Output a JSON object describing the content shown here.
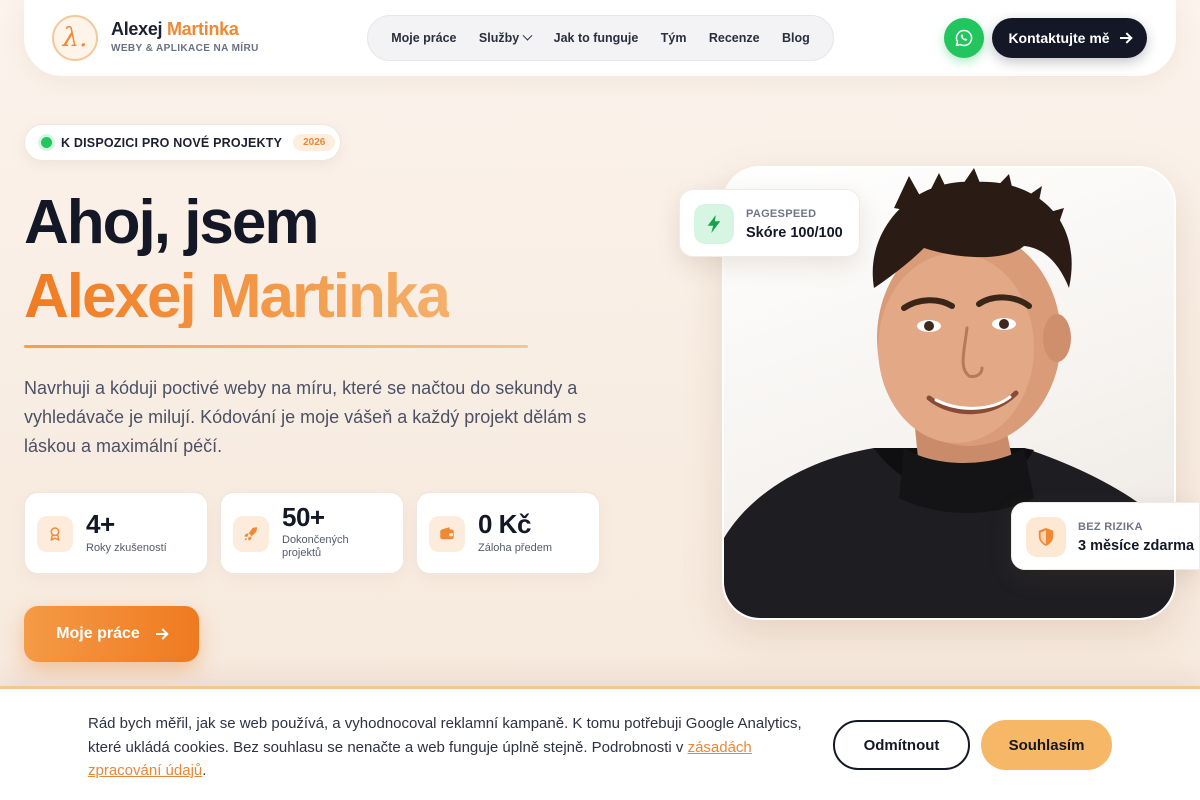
{
  "header": {
    "brand_first": "Alexej",
    "brand_last": "Martinka",
    "brand_tagline": "WEBY & APLIKACE NA MÍRU",
    "brand_logo_glyph": "λ.",
    "nav": [
      {
        "label": "Moje práce"
      },
      {
        "label": "Služby",
        "has_dropdown": true
      },
      {
        "label": "Jak to funguje"
      },
      {
        "label": "Tým"
      },
      {
        "label": "Recenze"
      },
      {
        "label": "Blog"
      }
    ],
    "whatsapp_icon": "whatsapp-icon",
    "contact_label": "Kontaktujte mě"
  },
  "hero": {
    "availability_text": "K DISPOZICI PRO NOVÉ PROJEKTY",
    "availability_year": "2026",
    "title_line1": "Ahoj, jsem",
    "title_line2": "Alexej Martinka",
    "description": "Navrhuji a kóduji poctivé weby na míru, které se načtou do sekundy a vyhledávače je milují. Kódování je moje vášeň a každý projekt dělám s láskou a maximální péčí.",
    "stats": [
      {
        "icon": "award-icon",
        "value": "4+",
        "label": "Roky zkušeností"
      },
      {
        "icon": "rocket-icon",
        "value": "50+",
        "label": "Dokončených projektů"
      },
      {
        "icon": "wallet-icon",
        "value": "0 Kč",
        "label": "Záloha předem"
      }
    ],
    "cta_label": "Moje práce"
  },
  "badges": {
    "pagespeed_caption": "PAGESPEED",
    "pagespeed_value": "Skóre 100/100",
    "risk_caption": "BEZ RIZIKA",
    "risk_value": "3 měsíce zdarma"
  },
  "cookie": {
    "text": "Rád bych měřil, jak se web používá, a vyhodnocoval reklamní kampaně. K tomu potřebuji Google Analytics, které ukládá cookies. Bez souhlasu se nenačte a web funguje úplně stejně. Podrobnosti v ",
    "link_text": "zásadách zpracování údajů",
    "text_end": ".",
    "decline_label": "Odmítnout",
    "accept_label": "Souhlasím"
  },
  "colors": {
    "accent": "#ee8a35",
    "dark": "#141826",
    "success": "#22c55e"
  }
}
